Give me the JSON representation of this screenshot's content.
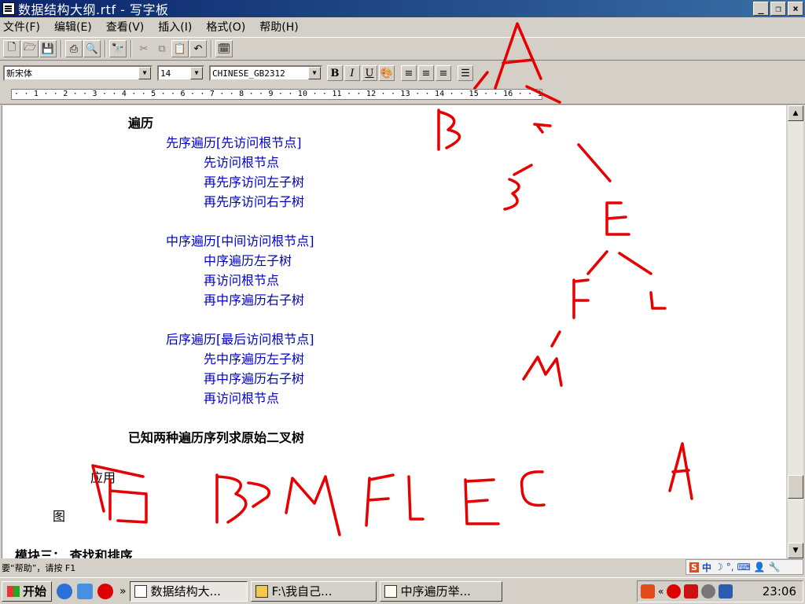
{
  "window": {
    "title": "数据结构大纲.rtf - 写字板",
    "minimize": "_",
    "restore": "❐",
    "close": "×"
  },
  "menu": [
    "文件(F)",
    "编辑(E)",
    "查看(V)",
    "插入(I)",
    "格式(O)",
    "帮助(H)"
  ],
  "format": {
    "font": "新宋体",
    "size": "14",
    "script": "CHINESE_GB2312",
    "bold": "B",
    "italic": "I",
    "underline": "U"
  },
  "ruler": "· · 1 · · 2 · · 3 · · 4 · · 5 · · 6 · · 7 · · 8 · · 9 · · 10 · · 11 · · 12 · · 13 · · 14 · · 15 · · 16 · · 17 ·",
  "document": {
    "heading": "遍历",
    "preorder_title": "先序遍历[先访问根节点]",
    "preorder_items": [
      "先访问根节点",
      "再先序访问左子树",
      "再先序访问右子树"
    ],
    "inorder_title": "中序遍历[中间访问根节点]",
    "inorder_items": [
      "中序遍历左子树",
      "再访问根节点",
      "再中序遍历右子树"
    ],
    "postorder_title": "后序遍历[最后访问根节点]",
    "postorder_items": [
      "先中序遍历左子树",
      "再中序遍历右子树",
      "再访问根节点"
    ],
    "known": "已知两种遍历序列求原始二叉树",
    "app": "应用",
    "graph": "图",
    "module3": "模块三： 查找和排序"
  },
  "status": "要“帮助”，请按 F1",
  "ime": {
    "logo": "S",
    "mode": "中"
  },
  "taskbar": {
    "start": "开始",
    "more": "»",
    "tasks": [
      "数据结构大...",
      "F:\\我自己...",
      "中序遍历举..."
    ],
    "tray_more": "«",
    "clock": "23:06"
  },
  "colors": {
    "ink": "#e60000",
    "body_text": "#0000c0",
    "title_bar": "#0a246a"
  }
}
